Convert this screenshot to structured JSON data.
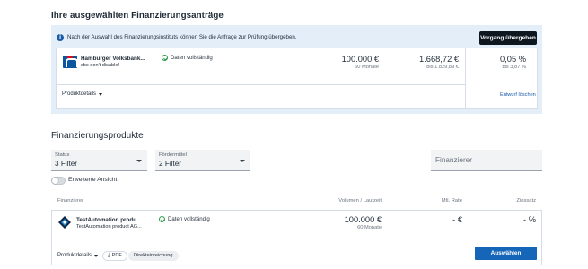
{
  "selected": {
    "title": "Ihre ausgewählten Finanzierungsanträge",
    "info_text": "Nach der Auswahl des Finanzierungsinstituts können Sie die Anfrage zur Prüfung übergeben.",
    "submit_label": "Vorgang übergeben",
    "card": {
      "bank_name": "Hamburger Volksbank...",
      "bank_sub": "sbc don't disable!",
      "status": "Daten vollständig",
      "amount": "100.000 €",
      "duration": "60 Monate",
      "rate": "1.668,72 €",
      "rate_range": "bis 1.829,89 €",
      "interest": "0,05 %",
      "interest_range": "bis 3,87 %",
      "details_label": "Produktdetails",
      "remove_label": "Entwurf löschen"
    }
  },
  "products": {
    "title": "Finanzierungsprodukte",
    "filters": {
      "status_label": "Status",
      "status_value": "3 Filter",
      "foerder_label": "Fördermittel",
      "foerder_value": "2 Filter",
      "search_placeholder": "Finanzierer"
    },
    "toggle_label": "Erweiterte Ansicht",
    "columns": {
      "financier": "Finanzierer",
      "volume": "Volumen / Laufzeit",
      "rate": "Mtl. Rate",
      "interest": "Zinssatz"
    },
    "card": {
      "name": "TestAutomation produ...",
      "sub": "TestAutomation product AG...",
      "status": "Daten vollständig",
      "amount": "100.000 €",
      "duration": "60 Monate",
      "rate": "- €",
      "interest": "- %",
      "details_label": "Produktdetails",
      "pdf_label": "PDF",
      "tag_label": "Direkteinreichung",
      "select_label": "Auswählen"
    }
  },
  "colors": {
    "accent": "#1565b8",
    "dark_button": "#0e1620",
    "info_bg": "#e4eef9",
    "success": "#2e9e4f"
  }
}
